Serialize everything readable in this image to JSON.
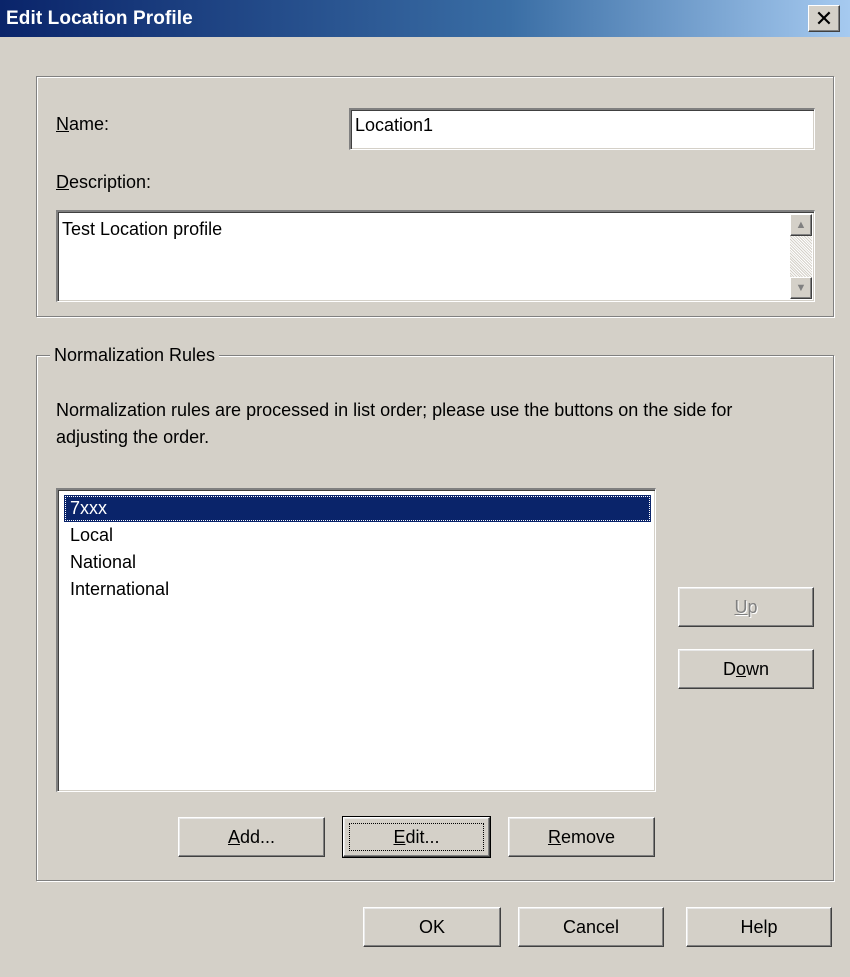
{
  "window": {
    "title": "Edit Location Profile",
    "close_glyph": "✕"
  },
  "profile": {
    "name_label": "Name:",
    "name_value": "Location1",
    "description_label": "Description:",
    "description_value": "Test Location profile"
  },
  "rules": {
    "group_label": "Normalization Rules",
    "hint": "Normalization rules are processed in list order; please use the buttons on the side for adjusting the order.",
    "items": [
      "7xxx",
      "Local",
      "National",
      "International"
    ],
    "selected_index": 0,
    "up_label": "Up",
    "down_label": "Down",
    "add_label": "Add...",
    "edit_label": "Edit...",
    "remove_label": "Remove"
  },
  "footer": {
    "ok_label": "OK",
    "cancel_label": "Cancel",
    "help_label": "Help"
  },
  "icons": {
    "scroll_up": "▲",
    "scroll_down": "▼"
  },
  "colors": {
    "title_start": "#0a246a",
    "title_end": "#a6caf0",
    "face": "#d4d0c8",
    "selection": "#0a246a"
  }
}
